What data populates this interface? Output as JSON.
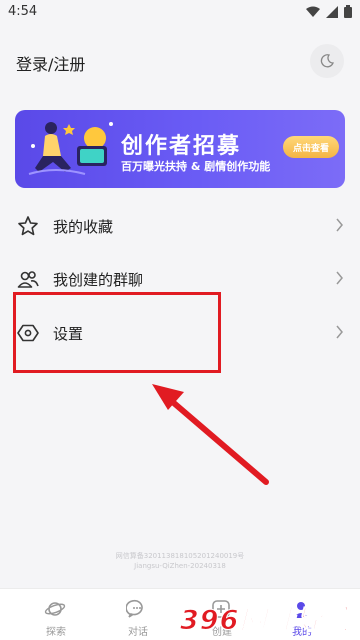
{
  "status_bar": {
    "time": "4:54"
  },
  "header": {
    "login_label": "登录/注册"
  },
  "banner": {
    "title": "创作者招募",
    "subtitle": "百万曝光扶持 & 剧情创作功能",
    "button_label": "点击查看"
  },
  "menu": [
    {
      "label": "我的收藏",
      "icon": "star-icon"
    },
    {
      "label": "我创建的群聊",
      "icon": "group-icon"
    },
    {
      "label": "设置",
      "icon": "settings-icon"
    }
  ],
  "footer": {
    "line1": "网信算备320113818105201240019号",
    "line2": "Jiangsu-QiZhen-20240318"
  },
  "tabs": [
    {
      "label": "探索",
      "icon": "planet-icon"
    },
    {
      "label": "对话",
      "icon": "chat-bubble-icon"
    },
    {
      "label": "创建",
      "icon": "plus-icon"
    },
    {
      "label": "",
      "icon": ""
    },
    {
      "label": "我的",
      "icon": "profile-icon",
      "active": true
    }
  ],
  "watermark": {
    "text": "396网址导航"
  },
  "colors": {
    "accent": "#5a49e8",
    "highlight": "#e11b22"
  }
}
